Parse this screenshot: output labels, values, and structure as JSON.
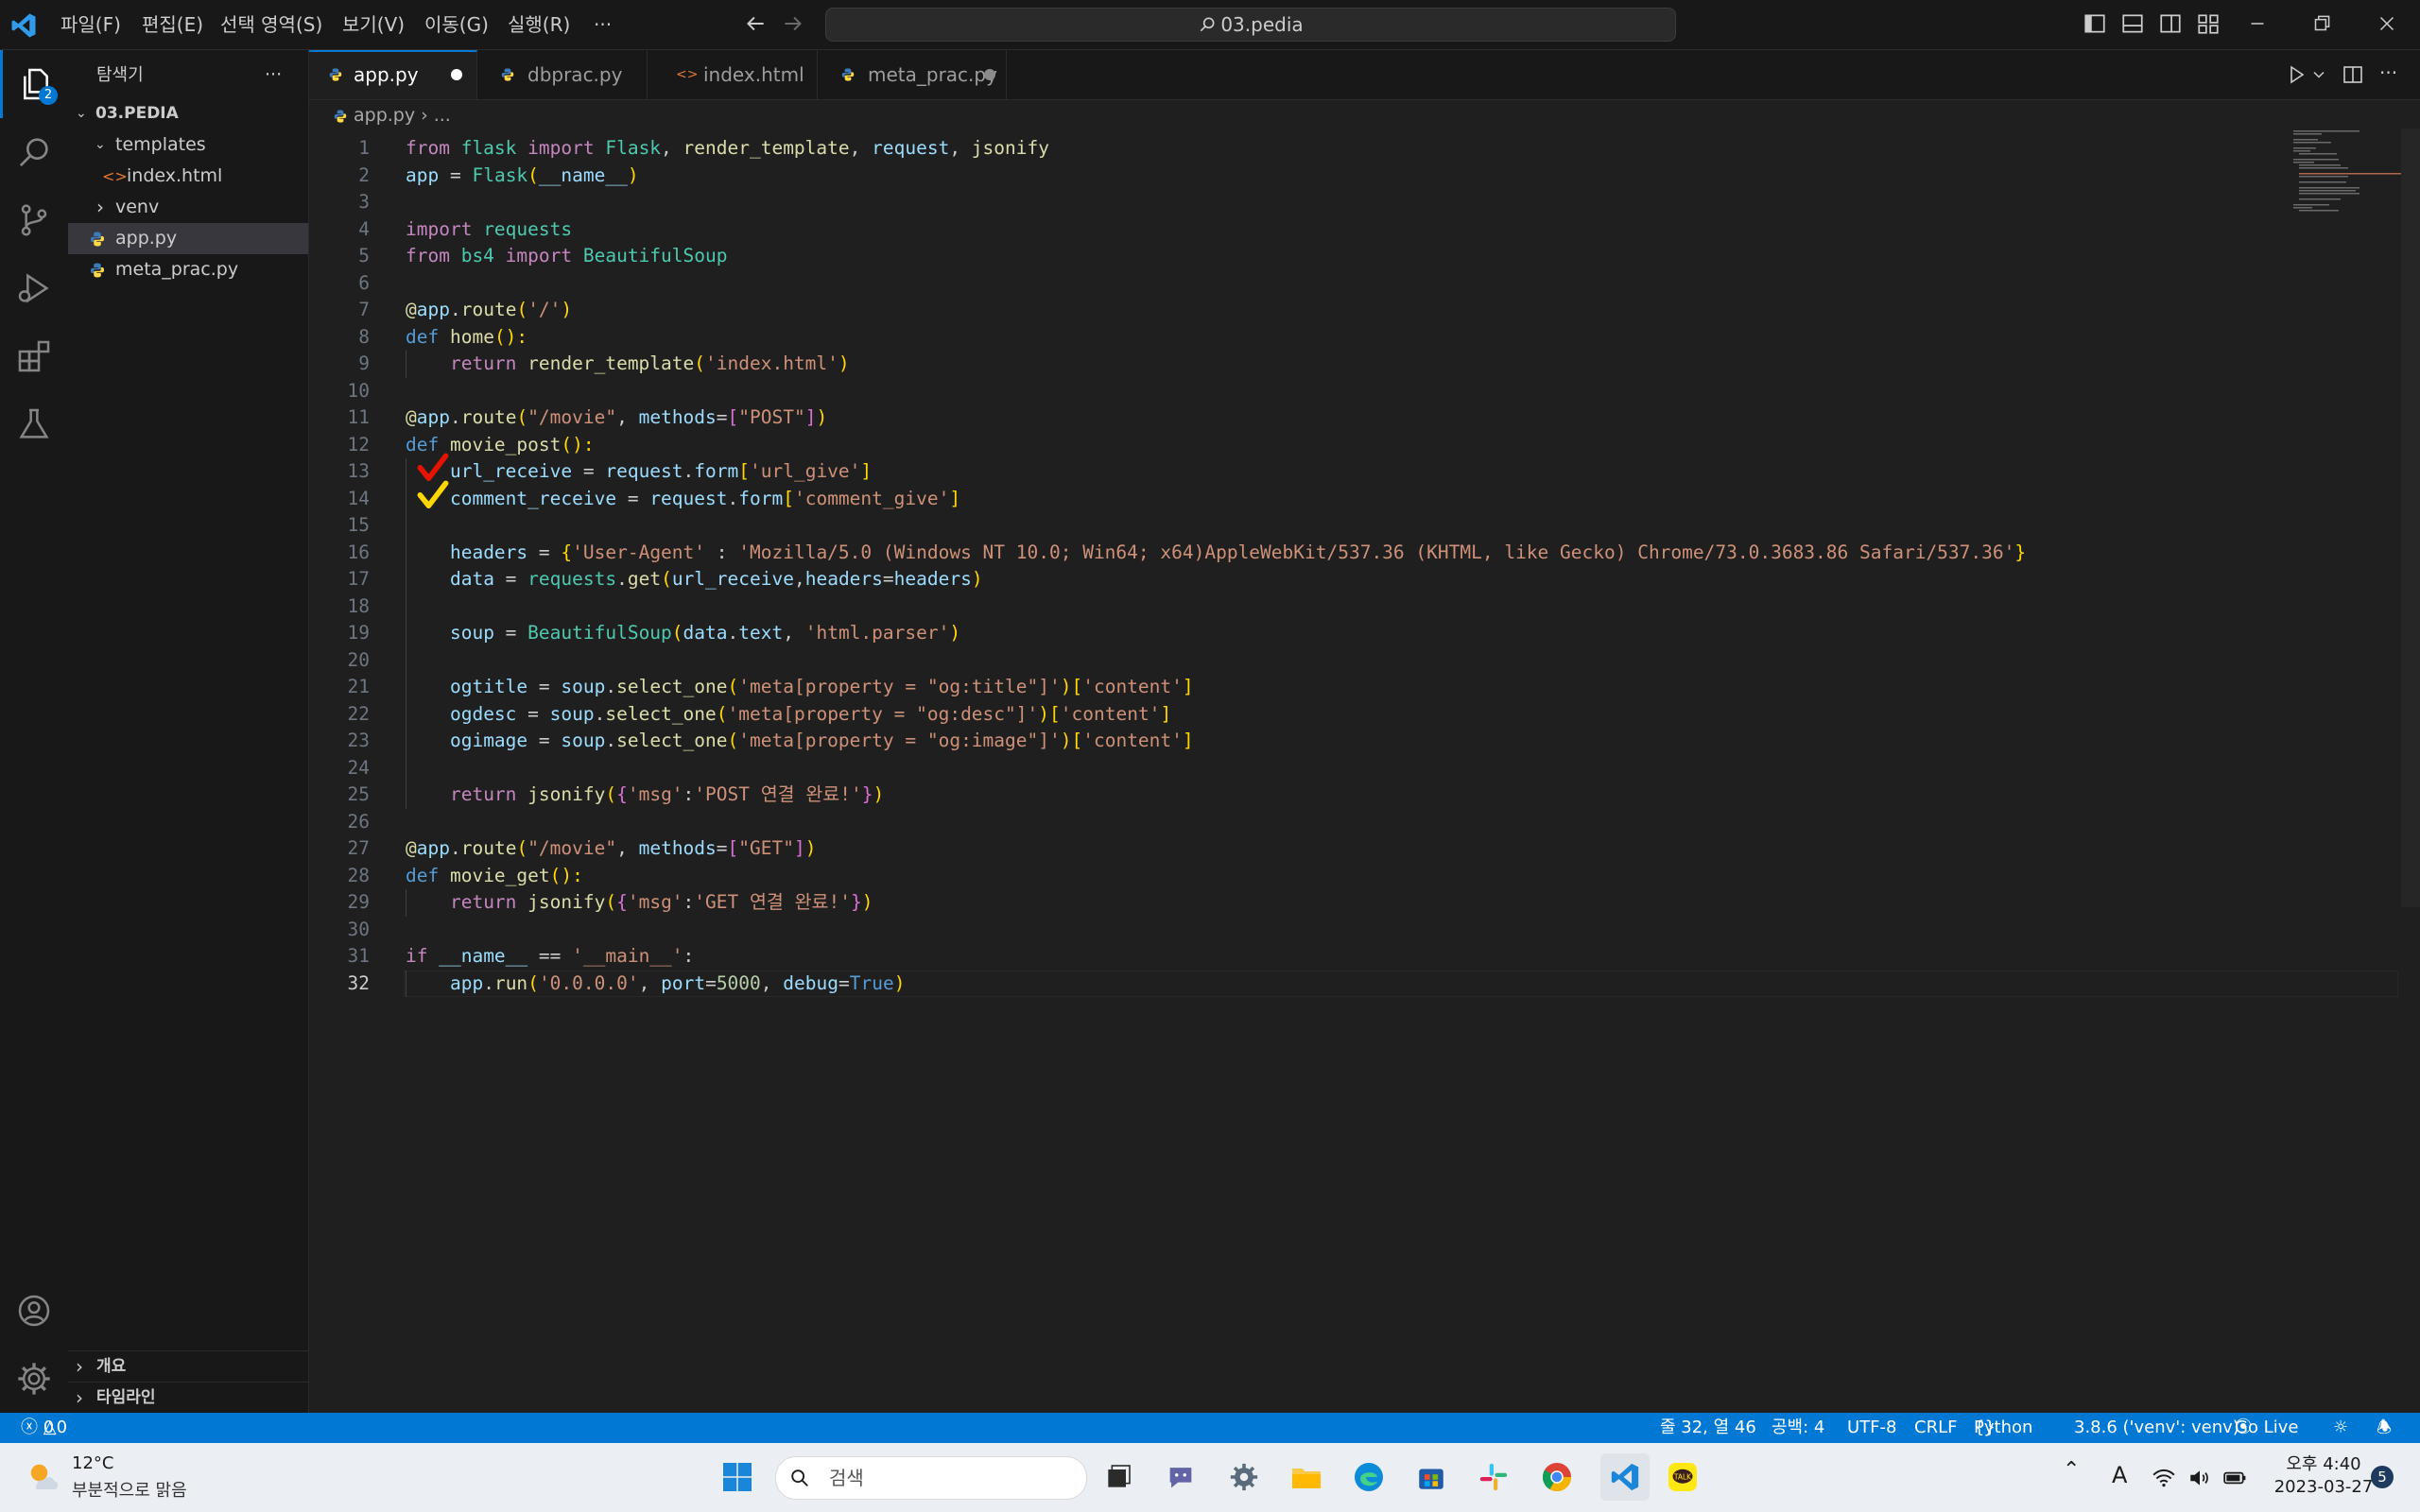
{
  "window": {
    "menu": [
      "파일(F)",
      "편집(E)",
      "선택 영역(S)",
      "보기(V)",
      "이동(G)",
      "실행(R)",
      "···"
    ],
    "search_text": "03.pedia"
  },
  "sidebar": {
    "title": "탐색기",
    "more": "···",
    "root": "03.PEDIA",
    "items": [
      {
        "label": "templates",
        "kind": "folder-open"
      },
      {
        "label": "index.html",
        "kind": "html"
      },
      {
        "label": "venv",
        "kind": "folder-closed"
      },
      {
        "label": "app.py",
        "kind": "python",
        "selected": true
      },
      {
        "label": "meta_prac.py",
        "kind": "python"
      }
    ],
    "outline": "개요",
    "timeline": "타임라인",
    "explorer_badge": "2"
  },
  "tabs": [
    {
      "label": "app.py",
      "icon": "python-icon",
      "modified": true,
      "active": true
    },
    {
      "label": "dbprac.py",
      "icon": "python-icon",
      "modified": false
    },
    {
      "label": "index.html",
      "icon": "html-icon",
      "modified": false
    },
    {
      "label": "meta_prac.py",
      "icon": "python-icon",
      "modified": true
    }
  ],
  "breadcrumb": {
    "file": "app.py",
    "rest": "..."
  },
  "editor": {
    "current_line": 32,
    "check_marks": [
      {
        "line": 13,
        "color": "#e51400"
      },
      {
        "line": 14,
        "color": "#ffd700"
      }
    ],
    "lines": [
      [
        [
          "from ",
          "kw"
        ],
        [
          "flask ",
          "cl"
        ],
        [
          "import ",
          "kw"
        ],
        [
          "Flask",
          "cl"
        ],
        [
          ", ",
          ""
        ],
        [
          "render_template",
          "fn"
        ],
        [
          ", ",
          ""
        ],
        [
          "request",
          "vr"
        ],
        [
          ", ",
          ""
        ],
        [
          "jsonify",
          "fn"
        ]
      ],
      [
        [
          "app",
          "vr"
        ],
        [
          " = ",
          ""
        ],
        [
          "Flask",
          "cl"
        ],
        [
          "(",
          "p1"
        ],
        [
          "__name__",
          "vr"
        ],
        [
          ")",
          "p1"
        ]
      ],
      [],
      [
        [
          "import ",
          "kw"
        ],
        [
          "requests",
          "cl"
        ]
      ],
      [
        [
          "from ",
          "kw"
        ],
        [
          "bs4 ",
          "cl"
        ],
        [
          "import ",
          "kw"
        ],
        [
          "BeautifulSoup",
          "cl"
        ]
      ],
      [],
      [
        [
          "@",
          "fn"
        ],
        [
          "app",
          "vr"
        ],
        [
          ".",
          ""
        ],
        [
          "route",
          "fn"
        ],
        [
          "(",
          "p1"
        ],
        [
          "'/'",
          "st"
        ],
        [
          ")",
          "p1"
        ]
      ],
      [
        [
          "def ",
          "kb"
        ],
        [
          "home",
          "fn"
        ],
        [
          "():",
          "p1"
        ]
      ],
      [
        [
          "    ",
          ""
        ],
        [
          "return ",
          "kw"
        ],
        [
          "render_template",
          "fn"
        ],
        [
          "(",
          "p1"
        ],
        [
          "'index.html'",
          "st"
        ],
        [
          ")",
          "p1"
        ]
      ],
      [],
      [
        [
          "@",
          "fn"
        ],
        [
          "app",
          "vr"
        ],
        [
          ".",
          ""
        ],
        [
          "route",
          "fn"
        ],
        [
          "(",
          "p1"
        ],
        [
          "\"/movie\"",
          "st"
        ],
        [
          ", ",
          ""
        ],
        [
          "methods",
          "vr"
        ],
        [
          "=",
          ""
        ],
        [
          "[",
          "p2"
        ],
        [
          "\"POST\"",
          "st"
        ],
        [
          "]",
          "p2"
        ],
        [
          ")",
          "p1"
        ]
      ],
      [
        [
          "def ",
          "kb"
        ],
        [
          "movie_post",
          "fn"
        ],
        [
          "():",
          "p1"
        ]
      ],
      [
        [
          "    ",
          ""
        ],
        [
          "url_receive",
          "vr"
        ],
        [
          " = ",
          ""
        ],
        [
          "request",
          "vr"
        ],
        [
          ".",
          ""
        ],
        [
          "form",
          "vr"
        ],
        [
          "[",
          "p1"
        ],
        [
          "'url_give'",
          "st"
        ],
        [
          "]",
          "p1"
        ]
      ],
      [
        [
          "    ",
          ""
        ],
        [
          "comment_receive",
          "vr"
        ],
        [
          " = ",
          ""
        ],
        [
          "request",
          "vr"
        ],
        [
          ".",
          ""
        ],
        [
          "form",
          "vr"
        ],
        [
          "[",
          "p1"
        ],
        [
          "'comment_give'",
          "st"
        ],
        [
          "]",
          "p1"
        ]
      ],
      [],
      [
        [
          "    ",
          ""
        ],
        [
          "headers",
          "vr"
        ],
        [
          " = ",
          ""
        ],
        [
          "{",
          "p1"
        ],
        [
          "'User-Agent'",
          "st"
        ],
        [
          " : ",
          ""
        ],
        [
          "'Mozilla/5.0 (Windows NT 10.0; Win64; x64)AppleWebKit/537.36 (KHTML, like Gecko) Chrome/73.0.3683.86 Safari/537.36'",
          "st"
        ],
        [
          "}",
          "p1"
        ]
      ],
      [
        [
          "    ",
          ""
        ],
        [
          "data",
          "vr"
        ],
        [
          " = ",
          ""
        ],
        [
          "requests",
          "cl"
        ],
        [
          ".",
          ""
        ],
        [
          "get",
          "fn"
        ],
        [
          "(",
          "p1"
        ],
        [
          "url_receive",
          "vr"
        ],
        [
          ",",
          ""
        ],
        [
          "headers",
          "vr"
        ],
        [
          "=",
          ""
        ],
        [
          "headers",
          "vr"
        ],
        [
          ")",
          "p1"
        ]
      ],
      [],
      [
        [
          "    ",
          ""
        ],
        [
          "soup",
          "vr"
        ],
        [
          " = ",
          ""
        ],
        [
          "BeautifulSoup",
          "cl"
        ],
        [
          "(",
          "p1"
        ],
        [
          "data",
          "vr"
        ],
        [
          ".",
          ""
        ],
        [
          "text",
          "vr"
        ],
        [
          ", ",
          ""
        ],
        [
          "'html.parser'",
          "st"
        ],
        [
          ")",
          "p1"
        ]
      ],
      [],
      [
        [
          "    ",
          ""
        ],
        [
          "ogtitle",
          "vr"
        ],
        [
          " = ",
          ""
        ],
        [
          "soup",
          "vr"
        ],
        [
          ".",
          ""
        ],
        [
          "select_one",
          "fn"
        ],
        [
          "(",
          "p1"
        ],
        [
          "'meta[property = \"og:title\"]'",
          "st"
        ],
        [
          ")",
          "p1"
        ],
        [
          "[",
          "p1"
        ],
        [
          "'content'",
          "st"
        ],
        [
          "]",
          "p1"
        ]
      ],
      [
        [
          "    ",
          ""
        ],
        [
          "ogdesc",
          "vr"
        ],
        [
          " = ",
          ""
        ],
        [
          "soup",
          "vr"
        ],
        [
          ".",
          ""
        ],
        [
          "select_one",
          "fn"
        ],
        [
          "(",
          "p1"
        ],
        [
          "'meta[property = \"og:desc\"]'",
          "st"
        ],
        [
          ")",
          "p1"
        ],
        [
          "[",
          "p1"
        ],
        [
          "'content'",
          "st"
        ],
        [
          "]",
          "p1"
        ]
      ],
      [
        [
          "    ",
          ""
        ],
        [
          "ogimage",
          "vr"
        ],
        [
          " = ",
          ""
        ],
        [
          "soup",
          "vr"
        ],
        [
          ".",
          ""
        ],
        [
          "select_one",
          "fn"
        ],
        [
          "(",
          "p1"
        ],
        [
          "'meta[property = \"og:image\"]'",
          "st"
        ],
        [
          ")",
          "p1"
        ],
        [
          "[",
          "p1"
        ],
        [
          "'content'",
          "st"
        ],
        [
          "]",
          "p1"
        ]
      ],
      [],
      [
        [
          "    ",
          ""
        ],
        [
          "return ",
          "kw"
        ],
        [
          "jsonify",
          "fn"
        ],
        [
          "(",
          "p1"
        ],
        [
          "{",
          "p2"
        ],
        [
          "'msg'",
          "st"
        ],
        [
          ":",
          ""
        ],
        [
          "'POST 연결 완료!'",
          "st"
        ],
        [
          "}",
          "p2"
        ],
        [
          ")",
          "p1"
        ]
      ],
      [],
      [
        [
          "@",
          "fn"
        ],
        [
          "app",
          "vr"
        ],
        [
          ".",
          ""
        ],
        [
          "route",
          "fn"
        ],
        [
          "(",
          "p1"
        ],
        [
          "\"/movie\"",
          "st"
        ],
        [
          ", ",
          ""
        ],
        [
          "methods",
          "vr"
        ],
        [
          "=",
          ""
        ],
        [
          "[",
          "p2"
        ],
        [
          "\"GET\"",
          "st"
        ],
        [
          "]",
          "p2"
        ],
        [
          ")",
          "p1"
        ]
      ],
      [
        [
          "def ",
          "kb"
        ],
        [
          "movie_get",
          "fn"
        ],
        [
          "():",
          "p1"
        ]
      ],
      [
        [
          "    ",
          ""
        ],
        [
          "return ",
          "kw"
        ],
        [
          "jsonify",
          "fn"
        ],
        [
          "(",
          "p1"
        ],
        [
          "{",
          "p2"
        ],
        [
          "'msg'",
          "st"
        ],
        [
          ":",
          ""
        ],
        [
          "'GET 연결 완료!'",
          "st"
        ],
        [
          "}",
          "p2"
        ],
        [
          ")",
          "p1"
        ]
      ],
      [],
      [
        [
          "if ",
          "kw"
        ],
        [
          "__name__",
          "vr"
        ],
        [
          " == ",
          ""
        ],
        [
          "'__main__'",
          "st"
        ],
        [
          ":",
          ""
        ]
      ],
      [
        [
          "    ",
          ""
        ],
        [
          "app",
          "vr"
        ],
        [
          ".",
          ""
        ],
        [
          "run",
          "fn"
        ],
        [
          "(",
          "p1"
        ],
        [
          "'0.0.0.0'",
          "st"
        ],
        [
          ", ",
          ""
        ],
        [
          "port",
          "vr"
        ],
        [
          "=",
          ""
        ],
        [
          "5000",
          "nm"
        ],
        [
          ", ",
          ""
        ],
        [
          "debug",
          "vr"
        ],
        [
          "=",
          ""
        ],
        [
          "True",
          "kb"
        ],
        [
          ")",
          "p1"
        ]
      ]
    ]
  },
  "statusbar": {
    "errors": "0",
    "warnings": "0",
    "position": "줄 32, 열 46",
    "spaces": "공백: 4",
    "encoding": "UTF-8",
    "eol": "CRLF",
    "language": "Python",
    "interpreter": "3.8.6 ('venv': venv)",
    "golive": "Go Live"
  },
  "taskbar": {
    "weather_temp": "12°C",
    "weather_desc": "부분적으로 맑음",
    "search_placeholder": "검색",
    "ime": "A",
    "clock_time": "오후 4:40",
    "clock_date": "2023-03-27",
    "notification_count": "5"
  },
  "colors": {
    "accent": "#0078d4",
    "editor_bg": "#1f1f1f",
    "chrome_bg": "#181818"
  }
}
